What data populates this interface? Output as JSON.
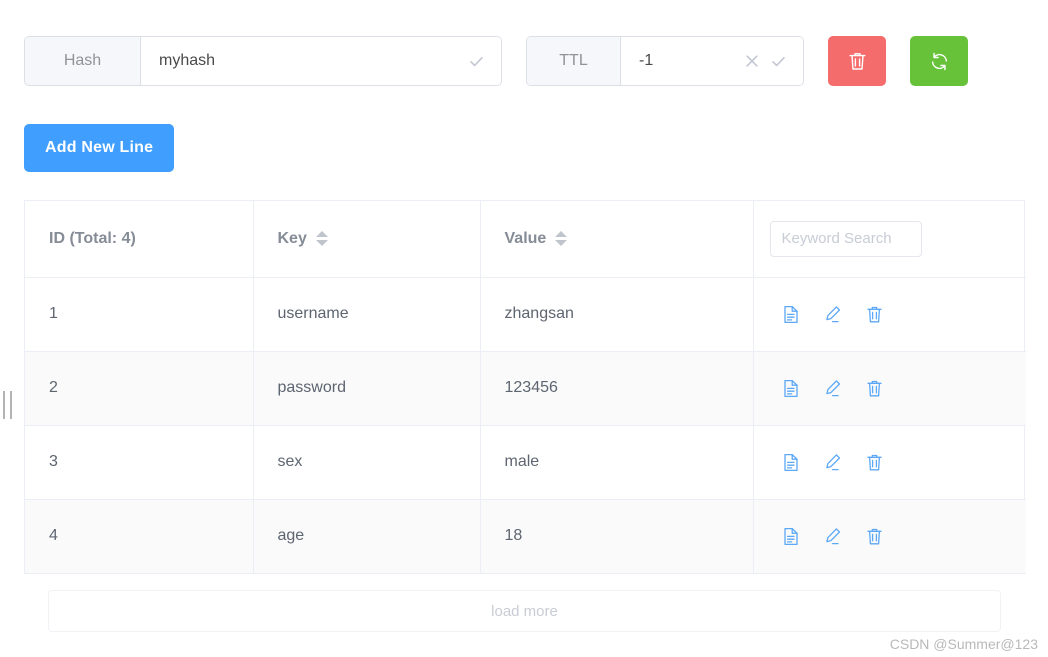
{
  "toolbar": {
    "hash": {
      "label": "Hash",
      "value": "myhash",
      "placeholder": "Hash",
      "confirm_icon": "check-icon"
    },
    "ttl": {
      "label": "TTL",
      "value": "-1",
      "placeholder": "TTL",
      "clear_icon": "close-icon",
      "confirm_icon": "check-icon"
    },
    "delete_button": {
      "icon": "trash-icon",
      "color": "#f56c6c"
    },
    "refresh_button": {
      "icon": "refresh-icon",
      "color": "#67c23a"
    },
    "add_new_line_label": "Add New Line"
  },
  "table": {
    "columns": [
      {
        "key": "id",
        "label": "ID (Total: 4)",
        "sortable": false
      },
      {
        "key": "k",
        "label": "Key",
        "sortable": true
      },
      {
        "key": "v",
        "label": "Value",
        "sortable": true
      },
      {
        "key": "actions",
        "label": "",
        "sortable": false
      }
    ],
    "search": {
      "value": "",
      "placeholder": "Keyword Search"
    },
    "row_action_icons": [
      "document-icon",
      "edit-icon",
      "trash-icon"
    ],
    "rows": [
      {
        "id": "1",
        "k": "username",
        "v": "zhangsan"
      },
      {
        "id": "2",
        "k": "password",
        "v": "123456"
      },
      {
        "id": "3",
        "k": "sex",
        "v": "male"
      },
      {
        "id": "4",
        "k": "age",
        "v": "18"
      }
    ]
  },
  "footer": {
    "load_more_label": "load more",
    "watermark": "CSDN @Summer@123"
  },
  "colors": {
    "primary": "#409eff",
    "danger": "#f56c6c",
    "success": "#67c23a",
    "icon_blue": "#5ca8f7"
  }
}
